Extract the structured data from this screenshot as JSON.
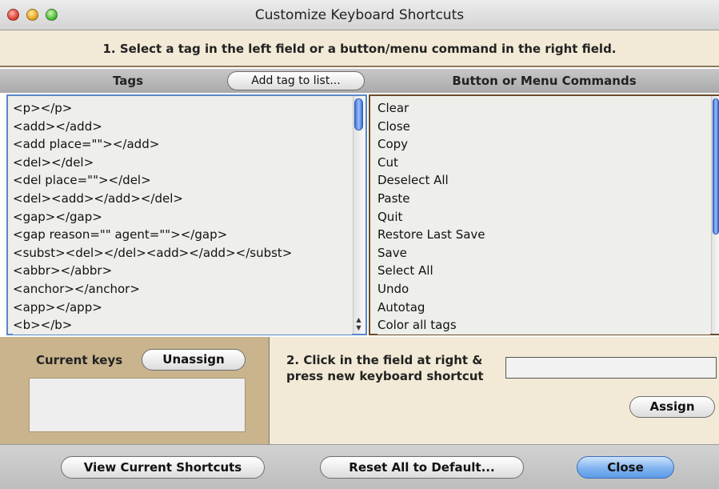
{
  "window": {
    "title": "Customize Keyboard Shortcuts"
  },
  "instructions": {
    "step1": "1. Select a tag in the left field or a button/menu command in the right field.",
    "step2_line1": "2. Click in the field at right &",
    "step2_line2": "press new keyboard shortcut"
  },
  "tags_panel": {
    "header": "Tags",
    "add_button": "Add tag to list...",
    "items": [
      "<p></p>",
      "<add></add>",
      "<add place=\"\"></add>",
      "<del></del>",
      "<del place=\"\"></del>",
      "<del><add></add></del>",
      "<gap></gap>",
      "<gap reason=\"\" agent=\"\"></gap>",
      "<subst><del></del><add></add></subst>",
      "<abbr></abbr>",
      "<anchor></anchor>",
      "<app></app>",
      "<b></b>"
    ]
  },
  "commands_panel": {
    "header": "Button or Menu Commands",
    "items": [
      "Clear",
      "Close",
      "Copy",
      "Cut",
      "Deselect All",
      "Paste",
      "Quit",
      "Restore Last Save",
      "Save",
      "Select All",
      "Undo",
      "Autotag",
      "Color all tags"
    ]
  },
  "current_keys": {
    "label": "Current keys",
    "unassign_button": "Unassign",
    "value": ""
  },
  "shortcut_field": {
    "value": ""
  },
  "assign_button": "Assign",
  "footer": {
    "view_button": "View Current Shortcuts",
    "reset_button": "Reset All to Default...",
    "close_button": "Close"
  },
  "colors": {
    "band_background": "#f2ead6",
    "current_keys_panel": "#c9b48d",
    "close_button_accent": "#7fb3f0",
    "scroll_thumb": "#3a6fd8"
  }
}
